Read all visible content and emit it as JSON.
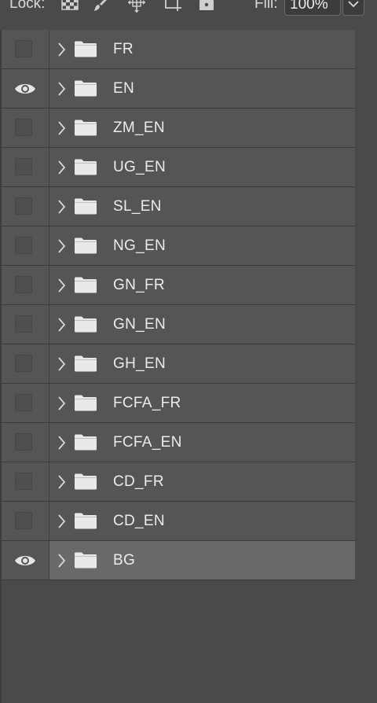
{
  "toolbar": {
    "lock_label": "Lock:",
    "fill_label": "Fill:",
    "fill_value": "100%",
    "lock_icons": [
      "lock-transparent-pixels-icon",
      "lock-image-pixels-icon",
      "lock-position-icon",
      "lock-artboard-icon",
      "lock-all-icon"
    ]
  },
  "layers": [
    {
      "name": "FR",
      "visible": false,
      "selected": false
    },
    {
      "name": "EN",
      "visible": true,
      "selected": false
    },
    {
      "name": "ZM_EN",
      "visible": false,
      "selected": false
    },
    {
      "name": "UG_EN",
      "visible": false,
      "selected": false
    },
    {
      "name": "SL_EN",
      "visible": false,
      "selected": false
    },
    {
      "name": "NG_EN",
      "visible": false,
      "selected": false
    },
    {
      "name": "GN_FR",
      "visible": false,
      "selected": false
    },
    {
      "name": "GN_EN",
      "visible": false,
      "selected": false
    },
    {
      "name": "GH_EN",
      "visible": false,
      "selected": false
    },
    {
      "name": "FCFA_FR",
      "visible": false,
      "selected": false
    },
    {
      "name": "FCFA_EN",
      "visible": false,
      "selected": false
    },
    {
      "name": "CD_FR",
      "visible": false,
      "selected": false
    },
    {
      "name": "CD_EN",
      "visible": false,
      "selected": false
    },
    {
      "name": "BG",
      "visible": true,
      "selected": true
    }
  ],
  "colors": {
    "panel_bg": "#4a4a4a",
    "row_bg": "#555555",
    "selected_row_bg": "#696969",
    "text": "#ececec"
  }
}
